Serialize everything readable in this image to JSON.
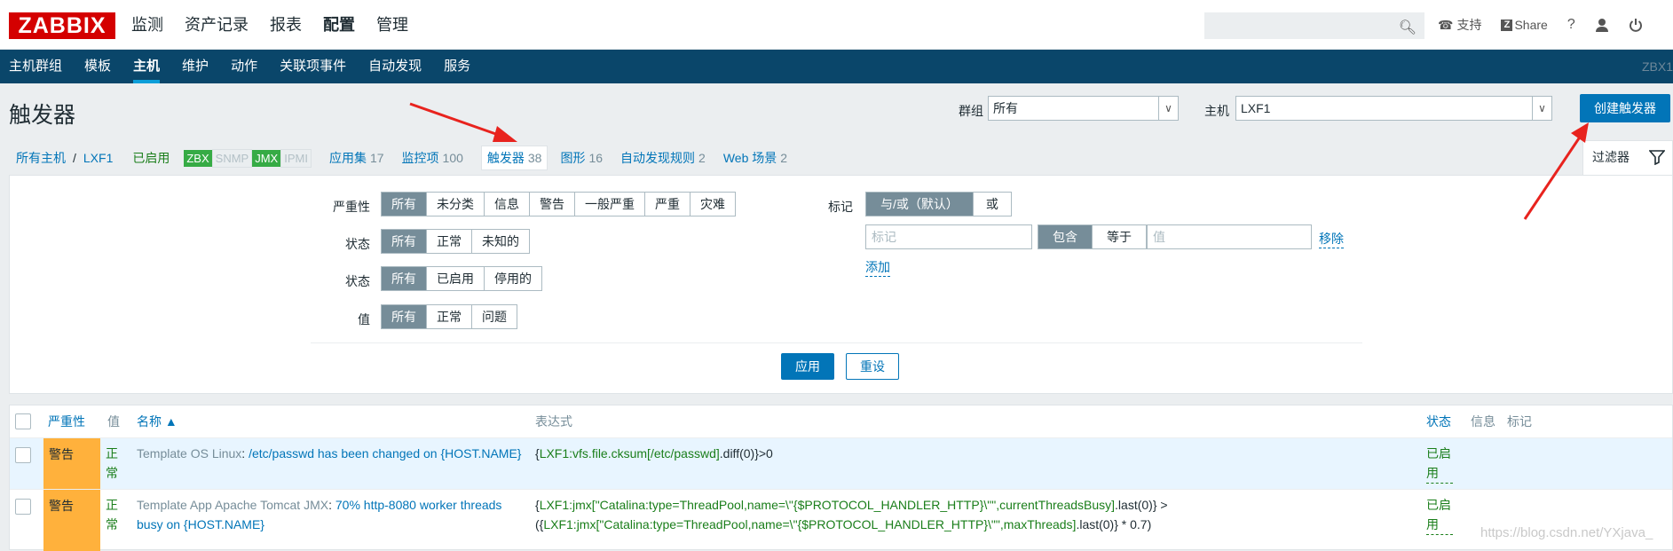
{
  "brand": {
    "logo": "ZABBIX",
    "color": "#d40000"
  },
  "topmenu": [
    "监测",
    "资产记录",
    "报表",
    "配置",
    "管理"
  ],
  "topmenu_active": "配置",
  "topright": {
    "support": "支持",
    "share": "Share",
    "help": "?"
  },
  "subnav": {
    "items": [
      "主机群组",
      "模板",
      "主机",
      "维护",
      "动作",
      "关联项事件",
      "自动发现",
      "服务"
    ],
    "active": "主机",
    "server_code": "ZBX1"
  },
  "header": {
    "title": "触发器",
    "group_label": "群组",
    "group_value": "所有",
    "host_label": "主机",
    "host_value": "LXF1",
    "create_button": "创建触发器"
  },
  "crumbs": {
    "all_hosts": "所有主机",
    "host": "LXF1",
    "enabled": "已启用",
    "badges": [
      "ZBX",
      "SNMP",
      "JMX",
      "IPMI"
    ],
    "tabs": [
      {
        "label": "应用集",
        "count": "17"
      },
      {
        "label": "监控项",
        "count": "100"
      },
      {
        "label": "触发器",
        "count": "38"
      },
      {
        "label": "图形",
        "count": "16"
      },
      {
        "label": "自动发现规则",
        "count": "2"
      },
      {
        "label": "Web 场景",
        "count": "2"
      }
    ],
    "filter_tab": "过滤器"
  },
  "filter": {
    "severity_label": "严重性",
    "severity_options": [
      "所有",
      "未分类",
      "信息",
      "警告",
      "一般严重",
      "严重",
      "灾难"
    ],
    "state_label": "状态",
    "state_options": [
      "所有",
      "正常",
      "未知的"
    ],
    "status_label": "状态",
    "status_options": [
      "所有",
      "已启用",
      "停用的"
    ],
    "value_label": "值",
    "value_options": [
      "所有",
      "正常",
      "问题"
    ],
    "tags_label": "标记",
    "tag_mode_options": [
      "与/或（默认）",
      "或"
    ],
    "tag_placeholder": "标记",
    "tag_op_options": [
      "包含",
      "等于"
    ],
    "value_placeholder": "值",
    "remove": "移除",
    "add": "添加",
    "apply": "应用",
    "reset": "重设"
  },
  "table": {
    "headers": {
      "severity": "严重性",
      "value": "值",
      "name": "名称 ▲",
      "expression": "表达式",
      "status": "状态",
      "info": "信息",
      "tags": "标记"
    },
    "rows": [
      {
        "severity": "警告",
        "value": "正常",
        "template": "Template OS Linux",
        "name_rest": "/etc/passwd has been changed on {HOST.NAME}",
        "expr_line1": [
          {
            "t": "{",
            "k": false
          },
          {
            "t": "LXF1:vfs.file.cksum[/etc/passwd]",
            "k": true
          },
          {
            "t": ".diff(0)}>0",
            "k": false
          }
        ],
        "expr_line2": [],
        "status": "已启用"
      },
      {
        "severity": "警告",
        "value": "正常",
        "template": "Template App Apache Tomcat JMX",
        "name_rest": "70% http-8080 worker threads busy on {HOST.NAME}",
        "expr_line1": [
          {
            "t": "{",
            "k": false
          },
          {
            "t": "LXF1:jmx[\"Catalina:type=ThreadPool,name=\\\"{$PROTOCOL_HANDLER_HTTP}\\\"\",currentThreadsBusy]",
            "k": true
          },
          {
            "t": ".last(0)} >",
            "k": false
          }
        ],
        "expr_line2": [
          {
            "t": "({",
            "k": false
          },
          {
            "t": "LXF1:jmx[\"Catalina:type=ThreadPool,name=\\\"{$PROTOCOL_HANDLER_HTTP}\\\"\",maxThreads]",
            "k": true
          },
          {
            "t": ".last(0)} * 0.7)",
            "k": false
          }
        ],
        "status": "已启用"
      }
    ]
  },
  "watermark": "https://blog.csdn.net/YXjava_"
}
